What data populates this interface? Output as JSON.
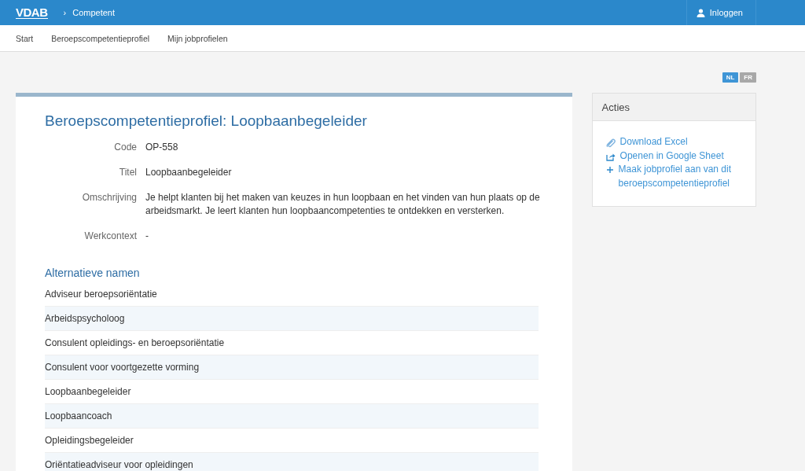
{
  "header": {
    "logo": "VDAB",
    "breadcrumb_separator": "›",
    "app_name": "Competent",
    "login": "Inloggen"
  },
  "nav": [
    "Start",
    "Beroepscompetentieprofiel",
    "Mijn jobprofielen"
  ],
  "languages": [
    {
      "label": "NL",
      "selected": true
    },
    {
      "label": "FR",
      "selected": false
    }
  ],
  "profile": {
    "title": "Beroepscompetentieprofiel: Loopbaanbegeleider",
    "fields": [
      {
        "label": "Code",
        "value": "OP-558"
      },
      {
        "label": "Titel",
        "value": "Loopbaanbegeleider"
      },
      {
        "label": "Omschrijving",
        "value": "Je helpt klanten bij het maken van keuzes in hun loopbaan en het vinden van hun plaats op de arbeidsmarkt. Je leert klanten hun loopbaancompetenties te ontdekken en versterken."
      },
      {
        "label": "Werkcontext",
        "value": "-"
      }
    ],
    "alternatives_title": "Alternatieve namen",
    "alternatives": [
      "Adviseur beroepsoriëntatie",
      "Arbeidspsycholoog",
      "Consulent opleidings- en beroepsoriëntatie",
      "Consulent voor voortgezette vorming",
      "Loopbaanbegeleider",
      "Loopbaancoach",
      "Opleidingsbegeleider",
      "Oriëntatieadviseur voor opleidingen"
    ]
  },
  "actions": {
    "title": "Acties",
    "items": [
      {
        "kind": "paperclip",
        "label": "Download Excel"
      },
      {
        "kind": "share",
        "label": "Openen in Google Sheet"
      },
      {
        "kind": "plus",
        "label": "Maak jobprofiel aan van dit beroepscompetentieprofiel"
      }
    ]
  }
}
